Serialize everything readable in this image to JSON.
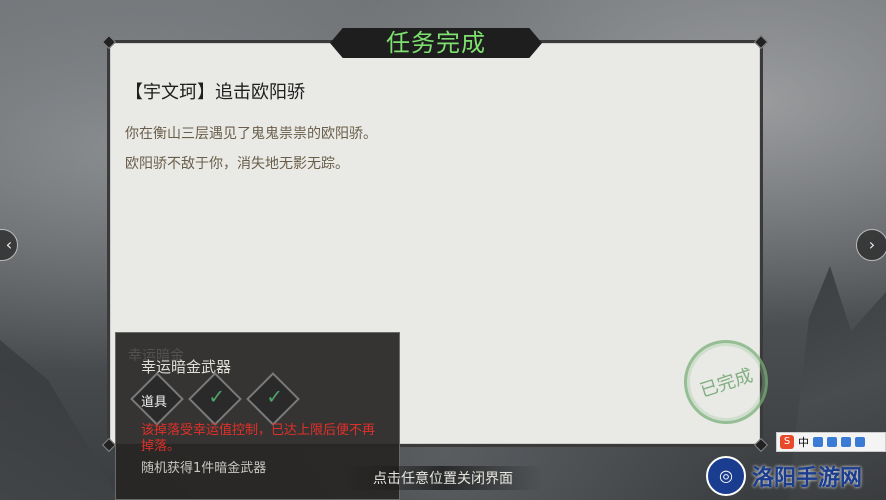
{
  "banner": {
    "title": "任务完成"
  },
  "quest": {
    "title": "【宇文珂】追击欧阳骄",
    "lines": [
      "你在衡山三层遇见了鬼鬼祟祟的欧阳骄。",
      "欧阳骄不敌于你，消失地无影无踪。"
    ]
  },
  "stamp": {
    "text": "已完成"
  },
  "reward": {
    "ghost_text": "幸运暗金",
    "name": "幸运暗金武器",
    "slot_label": "道具",
    "warning": "该掉落受幸运值控制，已达上限后便不再掉落。",
    "random": "随机获得1件暗金武器"
  },
  "close_hint": "点击任意位置关闭界面",
  "nav": {
    "left_icon": "chevron-left-icon",
    "right_icon": "chevron-right-icon",
    "left": "‹",
    "right": "›"
  },
  "ime": {
    "logo": "S",
    "mode": "中"
  },
  "watermark": {
    "text": "洛阳手游网"
  },
  "colors": {
    "banner_text": "#7ee06e",
    "warning": "#e0302a",
    "stamp": "#6ea56e"
  }
}
